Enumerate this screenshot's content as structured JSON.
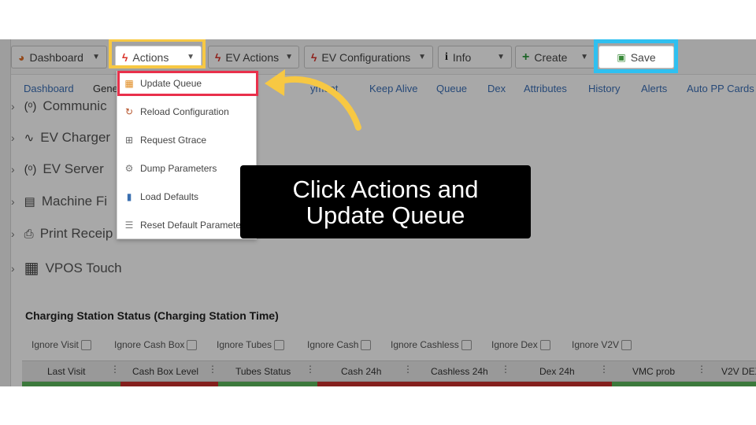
{
  "toolbar": {
    "dashboard": "Dashboard",
    "actions": "Actions",
    "ev_actions": "EV Actions",
    "ev_configurations": "EV Configurations",
    "info": "Info",
    "create": "Create",
    "save": "Save"
  },
  "subnav": [
    "Dashboard",
    "Gene",
    "yment",
    "Keep Alive",
    "Queue",
    "Dex",
    "Attributes",
    "History",
    "Alerts",
    "Auto PP Cards"
  ],
  "tree": [
    "Communic",
    "EV Charger",
    "EV Server",
    "Machine Fi",
    "Print Receip",
    "VPOS Touch"
  ],
  "actions_menu": [
    "Update Queue",
    "Reload Configuration",
    "Request Gtrace",
    "Dump Parameters",
    "Load Defaults",
    "Reset Default Parameters"
  ],
  "status": {
    "title": "Charging Station Status (Charging Station Time)",
    "filters": [
      "Ignore Visit",
      "Ignore Cash Box",
      "Ignore Tubes",
      "Ignore Cash",
      "Ignore Cashless",
      "Ignore Dex",
      "Ignore V2V"
    ],
    "columns": [
      "Last Visit",
      "Cash Box Level",
      "Tubes Status",
      "Cash 24h",
      "Cashless 24h",
      "Dex 24h",
      "VMC prob",
      "V2V DEX"
    ]
  },
  "callout": {
    "line1": "Click Actions and",
    "line2": "Update Queue"
  },
  "colors": {
    "actions_highlight": "#f7c843",
    "menu_item_highlight": "#e9304b",
    "save_highlight": "#2fc0f0",
    "arrow": "#f7c843",
    "row_ok": "#5cb85c",
    "row_alert": "#c9302c"
  }
}
